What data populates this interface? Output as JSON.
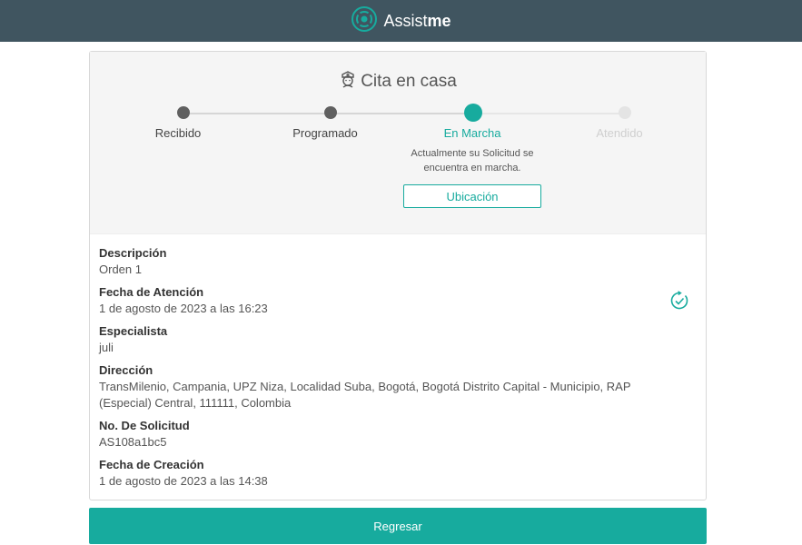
{
  "header": {
    "brand_light": "Assist",
    "brand_bold": "me"
  },
  "card": {
    "title": "Cita en casa",
    "steps": [
      {
        "label": "Recibido",
        "state": "done"
      },
      {
        "label": "Programado",
        "state": "done"
      },
      {
        "label": "En Marcha",
        "state": "active"
      },
      {
        "label": "Atendido",
        "state": "pending"
      }
    ],
    "active_description": "Actualmente su Solicitud se encuentra en marcha.",
    "location_button": "Ubicación"
  },
  "details": [
    {
      "label": "Descripción",
      "value": "Orden 1"
    },
    {
      "label": "Fecha de Atención",
      "value": "1 de agosto de 2023 a las 16:23"
    },
    {
      "label": "Especialista",
      "value": "juli"
    },
    {
      "label": "Dirección",
      "value": "TransMilenio, Campania, UPZ Niza, Localidad Suba, Bogotá, Bogotá Distrito Capital - Municipio, RAP (Especial) Central, 111111, Colombia"
    },
    {
      "label": "No. De Solicitud",
      "value": "AS108a1bc5"
    },
    {
      "label": "Fecha de Creación",
      "value": "1 de agosto de 2023 a las 14:38"
    }
  ],
  "footer": {
    "back_button": "Regresar"
  },
  "colors": {
    "accent": "#17ab9e",
    "topbar": "#405560"
  }
}
